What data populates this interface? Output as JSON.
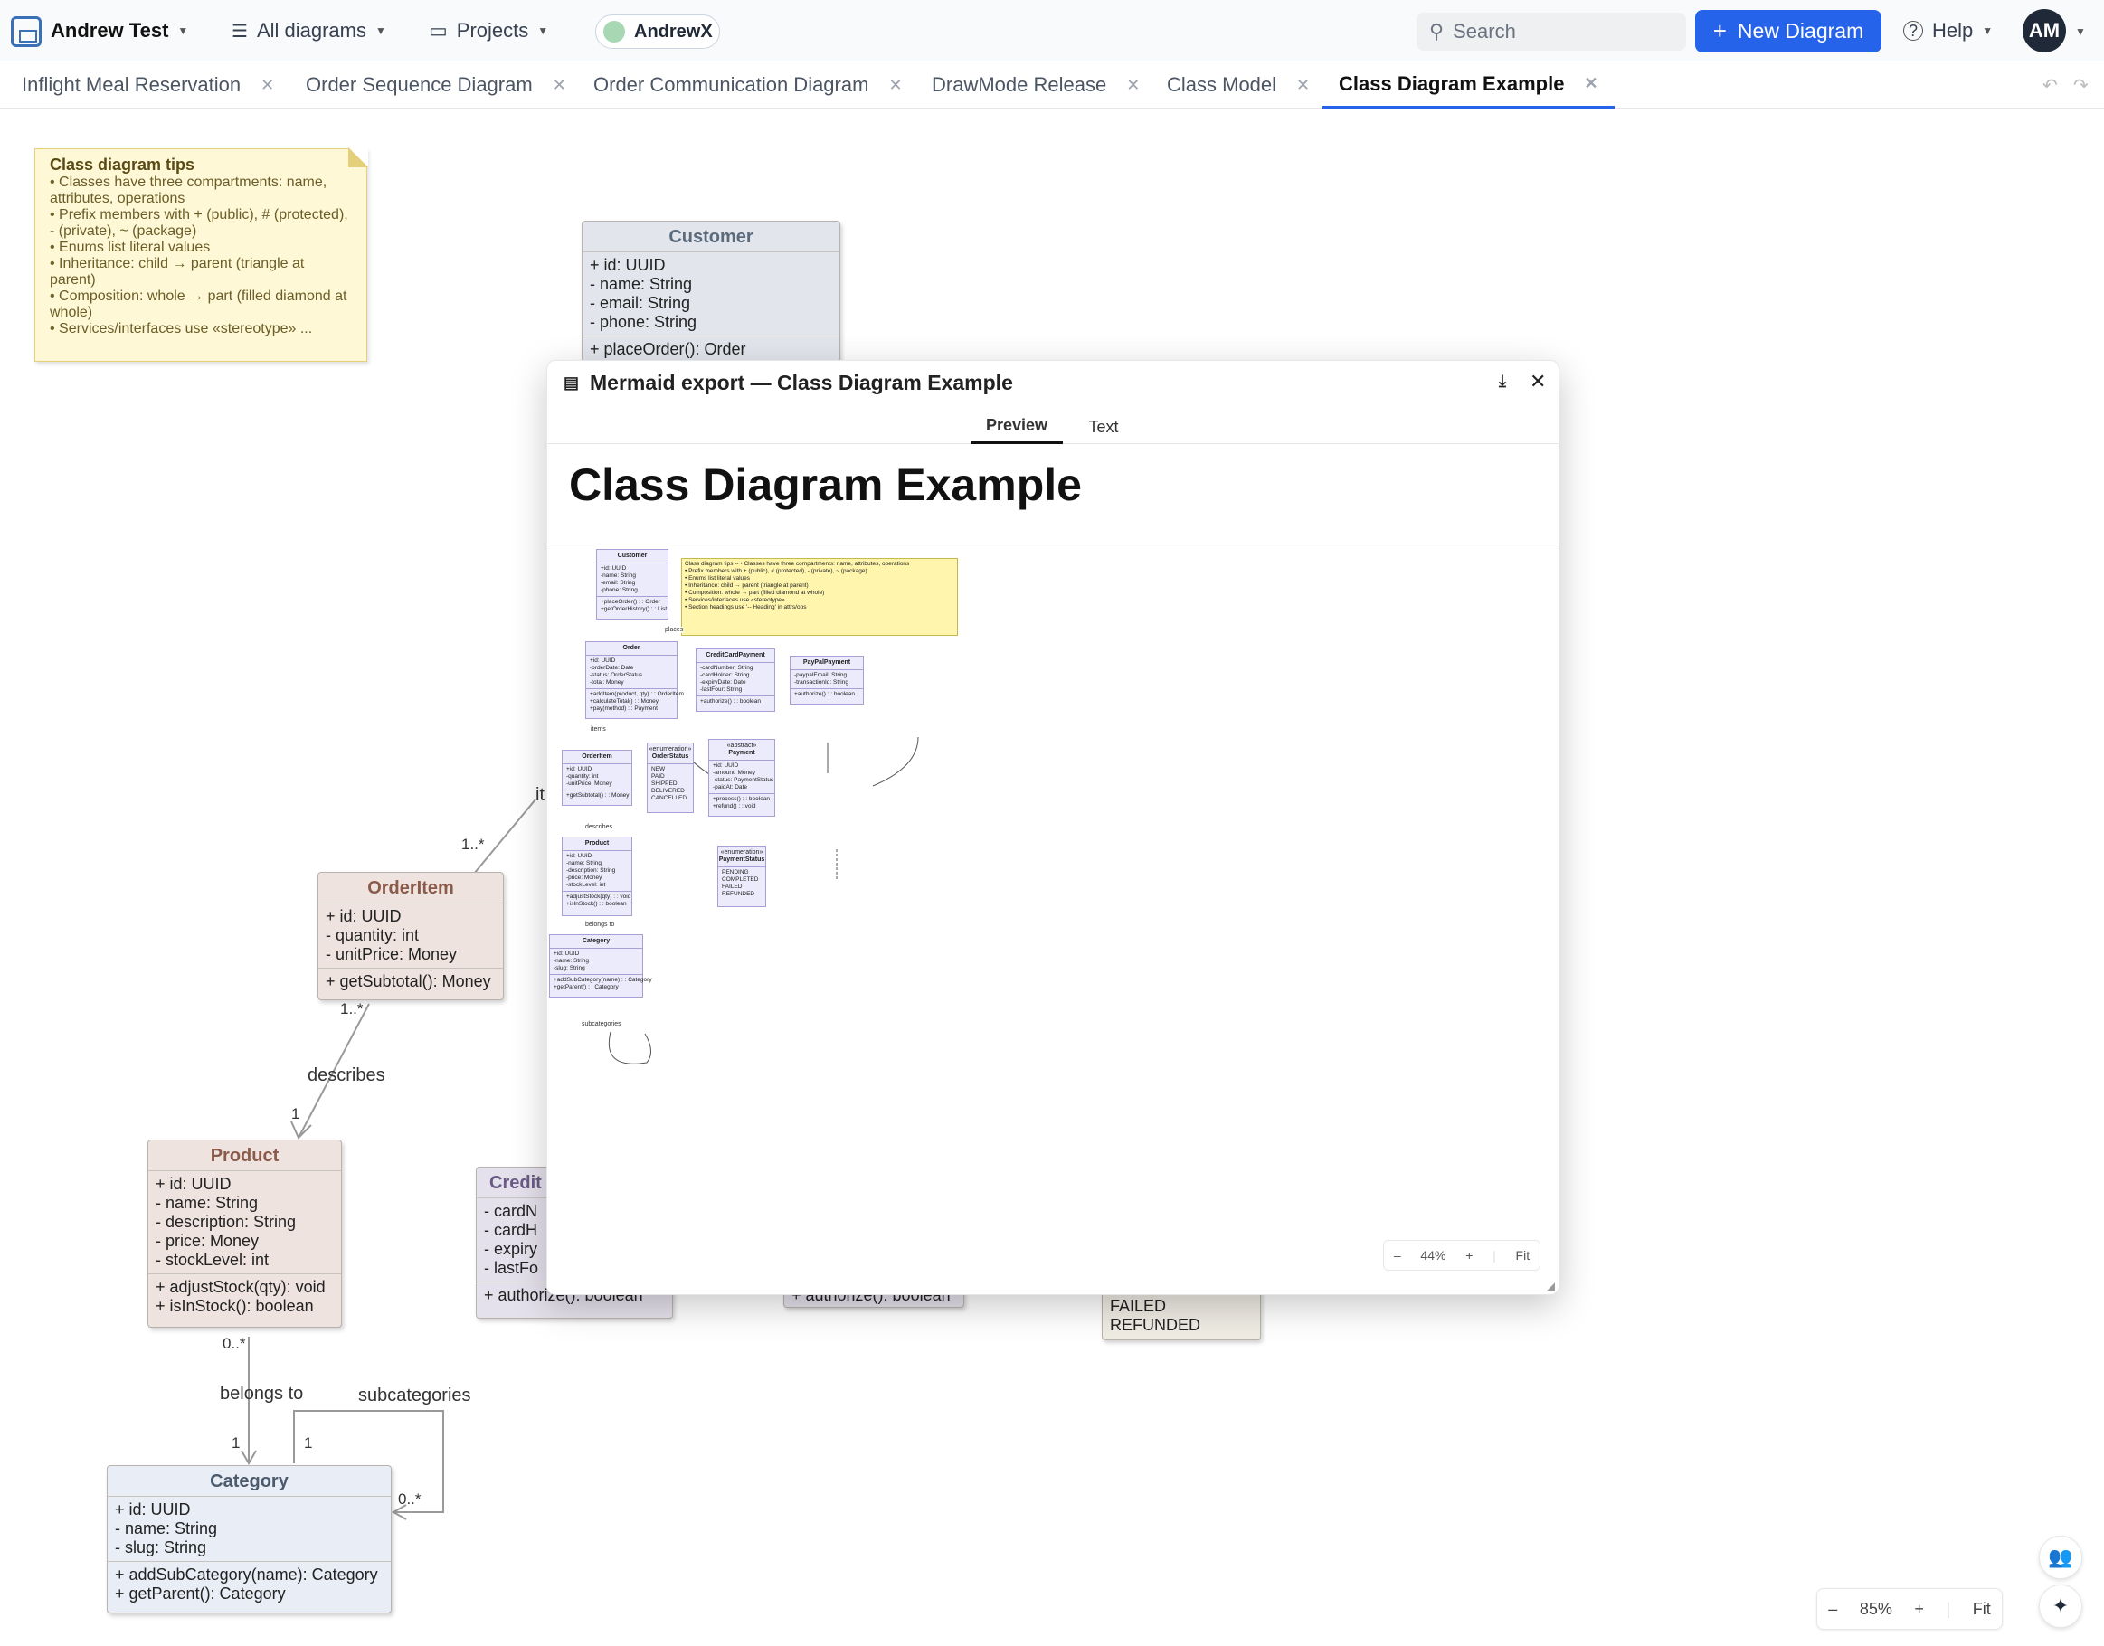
{
  "topbar": {
    "workspace": "Andrew Test",
    "diagrams_menu": "All diagrams",
    "projects_menu": "Projects",
    "user_pill": "AndrewX",
    "search_placeholder": "Search",
    "new_diagram": "New Diagram",
    "help": "Help",
    "avatar_initials": "AM"
  },
  "tabs": [
    {
      "label": "Inflight Meal Reservation"
    },
    {
      "label": "Order Sequence Diagram"
    },
    {
      "label": "Order Communication Diagram"
    },
    {
      "label": "DrawMode Release"
    },
    {
      "label": "Class Model"
    },
    {
      "label": "Class Diagram Example",
      "active": true
    }
  ],
  "note": {
    "title": "Class diagram tips",
    "lines": [
      "• Classes have three compartments: name, attributes, operations",
      "• Prefix members with + (public), # (protected), - (private), ~ (package)",
      "• Enums list literal values",
      "• Inheritance: child → parent (triangle at parent)",
      "• Composition: whole → part (filled diamond at whole)",
      "• Services/interfaces use «stereotype» ..."
    ]
  },
  "classes": {
    "customer": {
      "name": "Customer",
      "attrs": [
        "+ id: UUID",
        "- name: String",
        "- email: String",
        "- phone: String"
      ],
      "ops": [
        "+ placeOrder(): Order"
      ]
    },
    "orderitem": {
      "name": "OrderItem",
      "attrs": [
        "+ id: UUID",
        "- quantity: int",
        "- unitPrice: Money"
      ],
      "ops": [
        "+ getSubtotal(): Money"
      ]
    },
    "product": {
      "name": "Product",
      "attrs": [
        "+ id: UUID",
        "- name: String",
        "- description: String",
        "- price: Money",
        "- stockLevel: int"
      ],
      "ops": [
        "+ adjustStock(qty): void",
        "+ isInStock(): boolean"
      ]
    },
    "category": {
      "name": "Category",
      "attrs": [
        "+ id: UUID",
        "- name: String",
        "- slug: String"
      ],
      "ops": [
        "+ addSubCategory(name): Category",
        "+ getParent(): Category"
      ]
    },
    "credit": {
      "name": "Credit",
      "attrs": [
        "- cardN",
        "- cardH",
        "- expiry",
        "- lastFo"
      ],
      "ops": [
        "+ authorize(): boolean"
      ]
    },
    "payment_partial": {
      "ops": [
        "+ authorize(): boolean"
      ]
    },
    "status_partial": {
      "literals": [
        "FAILED",
        "REFUNDED"
      ]
    }
  },
  "edge_labels": {
    "it": "it",
    "m1": "1..*",
    "m2": "1..*",
    "describes": "describes",
    "one1": "1",
    "m3": "0..*",
    "belongs": "belongs to",
    "one2": "1",
    "subcats": "subcategories",
    "one3": "1",
    "m4": "0..*"
  },
  "zoom": {
    "minus": "–",
    "value": "85%",
    "plus": "+",
    "fit": "Fit"
  },
  "modal": {
    "title": "Mermaid export — Class Diagram Example",
    "tab_preview": "Preview",
    "tab_text": "Text",
    "doc_title": "Class Diagram Example",
    "zoom": {
      "minus": "–",
      "value": "44%",
      "plus": "+",
      "fit": "Fit"
    },
    "mini": {
      "customer": {
        "name": "Customer",
        "attrs": "+id: UUID\n-name: String\n-email: String\n-phone: String",
        "ops": "+placeOrder() : : Order\n+getOrderHistory() : : List"
      },
      "order": {
        "name": "Order",
        "attrs": "+id: UUID\n-orderDate: Date\n-status: OrderStatus\n-total: Money",
        "ops": "+addItem(product, qty) : : OrderItem\n+calculateTotal() : : Money\n+pay(method) : : Payment"
      },
      "ccp": {
        "name": "CreditCardPayment",
        "attrs": "-cardNumber: String\n-cardHolder: String\n-expiryDate: Date\n-lastFour: String",
        "ops": "+authorize() : : boolean"
      },
      "paypal": {
        "name": "PayPalPayment",
        "attrs": "-paypalEmail: String\n-transactionId: String",
        "ops": "+authorize() : : boolean"
      },
      "orderitem": {
        "name": "OrderItem",
        "attrs": "+id: UUID\n-quantity: int\n-unitPrice: Money",
        "ops": "+getSubtotal() : : Money"
      },
      "orderstatus": {
        "stereo": "«enumeration»",
        "name": "OrderStatus",
        "lits": "NEW\nPAID\nSHIPPED\nDELIVERED\nCANCELLED"
      },
      "payment": {
        "stereo": "«abstract»",
        "name": "Payment",
        "attrs": "+id: UUID\n-amount: Money\n-status: PaymentStatus\n-paidAt: Date",
        "ops": "+process() : : boolean\n+refund() : : void"
      },
      "product": {
        "name": "Product",
        "attrs": "+id: UUID\n-name: String\n-description: String\n-price: Money\n-stockLevel: int",
        "ops": "+adjustStock(qty) : : void\n+isInStock() : : boolean"
      },
      "paymentstatus": {
        "stereo": "«enumeration»",
        "name": "PaymentStatus",
        "lits": "PENDING\nCOMPLETED\nFAILED\nREFUNDED"
      },
      "category": {
        "name": "Category",
        "attrs": "+id: UUID\n-name: String\n-slug: String",
        "ops": "+addSubCategory(name) : : Category\n+getParent() : : Category"
      },
      "note": "Class diagram tips -- • Classes have three compartments: name, attributes, operations\n• Prefix members with + (public), # (protected), - (private), ~ (package)\n• Enums list literal values\n• Inheritance: child → parent (triangle at parent)\n• Composition: whole → part (filled diamond at whole)\n• Services/interfaces use «stereotype»\n• Section headings use '-- Heading' in attrs/ops",
      "labels": {
        "places": "places",
        "items": "items",
        "describes": "describes",
        "belongs": "belongs to",
        "subcats": "subcategories"
      }
    }
  }
}
